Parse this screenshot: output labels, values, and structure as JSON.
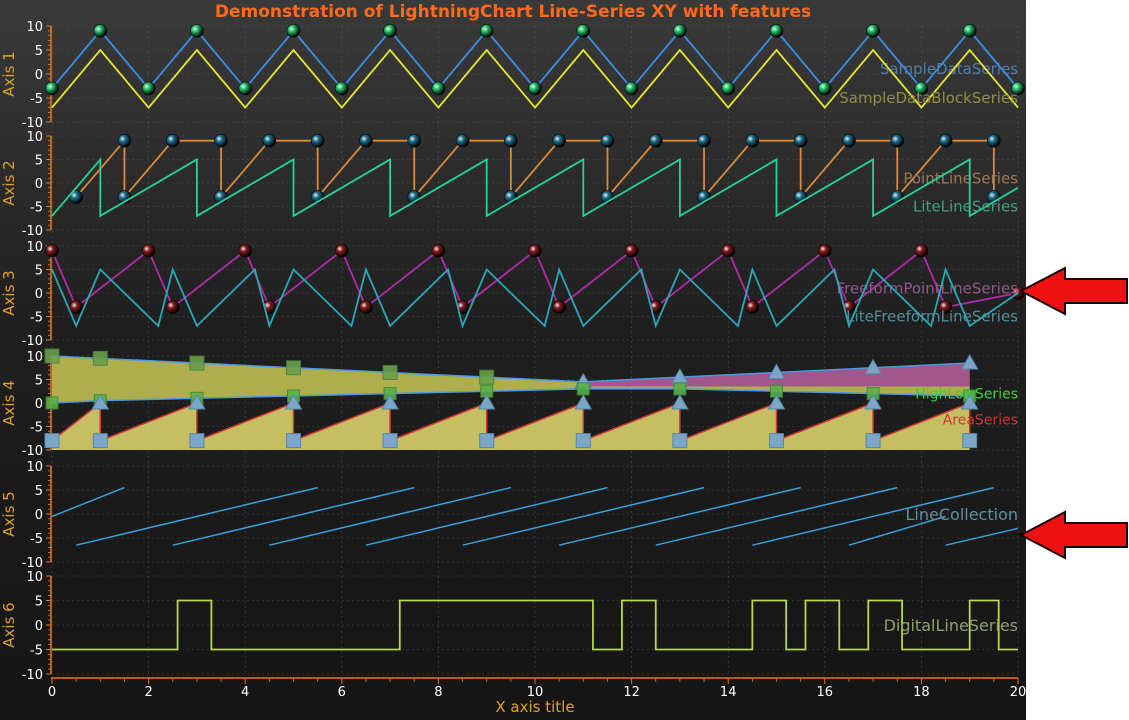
{
  "chart_data": {
    "type": "line",
    "title": "Demonstration of LightningChart Line-Series XY with features",
    "xlabel": "X axis title",
    "xlim": [
      0,
      20
    ],
    "x_ticks": [
      "0",
      "2",
      "4",
      "6",
      "8",
      "10",
      "12",
      "14",
      "16",
      "18",
      "20"
    ],
    "grid": true,
    "axes": [
      {
        "label": "Axis 1",
        "ylim": [
          -10,
          10
        ],
        "y_ticks": [
          "10",
          "5",
          "0",
          "-5",
          "-10"
        ],
        "series": [
          {
            "name": "SampleDataSeries",
            "color": "#3a8fe8",
            "label_color": "#4f7fb0",
            "marker": "circle",
            "marker_color": "#22c46a",
            "x": [
              0,
              1,
              2,
              3,
              4,
              5,
              6,
              7,
              8,
              9,
              10,
              11,
              12,
              13,
              14,
              15,
              16,
              17,
              18,
              19,
              20
            ],
            "y": [
              -3,
              9,
              -3,
              9,
              -3,
              9,
              -3,
              9,
              -3,
              9,
              -3,
              9,
              -3,
              9,
              -3,
              9,
              -3,
              9,
              -3,
              9,
              -3
            ]
          },
          {
            "name": "SampleDataBlockSeries",
            "color": "#e8e82a",
            "label_color": "#8f8f40",
            "marker": "none",
            "x": [
              0,
              1,
              2,
              3,
              4,
              5,
              6,
              7,
              8,
              9,
              10,
              11,
              12,
              13,
              14,
              15,
              16,
              17,
              18,
              19,
              20
            ],
            "y": [
              -7,
              5,
              -7,
              5,
              -7,
              5,
              -7,
              5,
              -7,
              5,
              -7,
              5,
              -7,
              5,
              -7,
              5,
              -7,
              5,
              -7,
              5,
              -7
            ]
          }
        ]
      },
      {
        "label": "Axis 2",
        "ylim": [
          -10,
          10
        ],
        "y_ticks": [
          "10",
          "5",
          "0",
          "-5",
          "-10"
        ],
        "series": [
          {
            "name": "PointLineSeries",
            "color": "#d98a3a",
            "label_color": "#a07850",
            "marker": "circle",
            "marker_color": "#1c6f8f",
            "x": [
              0.5,
              1.5,
              1.5,
              2.5,
              3.5,
              3.5,
              4.5,
              5.5,
              5.5,
              6.5,
              7.5,
              7.5,
              8.5,
              9.5,
              9.5,
              10.5,
              11.5,
              11.5,
              12.5,
              13.5,
              13.5,
              14.5,
              15.5,
              15.5,
              16.5,
              17.5,
              17.5,
              18.5,
              19.5,
              19.5
            ],
            "y": [
              -3,
              9,
              -3,
              9,
              9,
              -3,
              9,
              9,
              -3,
              9,
              9,
              -3,
              9,
              9,
              -3,
              9,
              9,
              -3,
              9,
              9,
              -3,
              9,
              9,
              -3,
              9,
              9,
              -3,
              9,
              9,
              -3
            ]
          },
          {
            "name": "LiteLineSeries",
            "color": "#22d49a",
            "label_color": "#3fa080",
            "marker": "none",
            "x": [
              0,
              1,
              1,
              3,
              3,
              5,
              5,
              7,
              7,
              9,
              9,
              11,
              11,
              13,
              13,
              15,
              15,
              17,
              17,
              19,
              19,
              20
            ],
            "y": [
              -7,
              5,
              -7,
              5,
              -7,
              5,
              -7,
              5,
              -7,
              5,
              -7,
              5,
              -7,
              5,
              -7,
              5,
              -7,
              5,
              -7,
              5,
              -7,
              -1
            ]
          }
        ]
      },
      {
        "label": "Axis 3",
        "ylim": [
          -10,
          10
        ],
        "y_ticks": [
          "10",
          "5",
          "0",
          "-5",
          "-10"
        ],
        "series": [
          {
            "name": "FreeformPointLineSeries",
            "color": "#b02aa8",
            "label_color": "#8f5a8a",
            "marker": "circle",
            "marker_color": "#8a1c1c",
            "x": [
              0,
              0.5,
              2,
              2.5,
              4,
              4.5,
              6,
              6.5,
              8,
              8.5,
              10,
              10.5,
              12,
              12.5,
              14,
              14.5,
              16,
              16.5,
              18,
              18.5,
              20
            ],
            "y": [
              9,
              -3,
              9,
              -3,
              9,
              -3,
              9,
              -3,
              9,
              -3,
              9,
              -3,
              9,
              -3,
              9,
              -3,
              9,
              -3,
              9,
              -3,
              0
            ]
          },
          {
            "name": "LiteFreeformLineSeries",
            "color": "#2aa8b8",
            "label_color": "#4f8f9a",
            "marker": "none",
            "x": [
              0,
              0.5,
              1,
              2.2,
              2.5,
              3,
              4.2,
              4.5,
              5,
              6.2,
              6.5,
              7,
              8.2,
              8.5,
              9,
              10.2,
              10.5,
              11,
              12.2,
              12.5,
              13,
              14.2,
              14.5,
              15,
              16.2,
              16.5,
              17,
              18.2,
              18.5,
              19,
              20
            ],
            "y": [
              5,
              -7,
              5,
              -7,
              5,
              -7,
              5,
              -7,
              5,
              -7,
              5,
              -7,
              5,
              -7,
              5,
              -7,
              5,
              -7,
              5,
              -7,
              5,
              -7,
              5,
              -7,
              5,
              -7,
              5,
              -7,
              5,
              -7,
              0
            ]
          }
        ]
      },
      {
        "label": "Axis 4",
        "ylim": [
          -10,
          10
        ],
        "y_ticks": [
          "10",
          "5",
          "0",
          "-5",
          "-10"
        ],
        "series": [
          {
            "name": "HighLowSeries",
            "color": "#c8c855",
            "label_color": "#3ecf3e",
            "marker": "square/triangle",
            "x": [
              0,
              1,
              3,
              5,
              7,
              9,
              11,
              13,
              15,
              17,
              19
            ],
            "high": [
              10,
              9.5,
              8.5,
              7.5,
              6.5,
              5.5,
              4.5,
              5.5,
              6.5,
              7.5,
              8.5
            ],
            "low": [
              0,
              0.5,
              1,
              1.5,
              2,
              2.5,
              3,
              3,
              2.5,
              2,
              1.5
            ]
          },
          {
            "name": "AreaSeries",
            "color": "#d8d06a",
            "label_color": "#d03535",
            "marker": "square/triangle",
            "x": [
              0,
              1,
              1,
              3,
              3,
              5,
              5,
              7,
              7,
              9,
              9,
              11,
              11,
              13,
              13,
              15,
              15,
              17,
              17,
              19,
              19
            ],
            "y": [
              -8,
              0,
              -8,
              0,
              -8,
              0,
              -8,
              0,
              -8,
              0,
              -8,
              0,
              -8,
              0,
              -8,
              0,
              -8,
              0,
              -8,
              0,
              -8
            ]
          }
        ]
      },
      {
        "label": "Axis 5",
        "ylim": [
          -10,
          10
        ],
        "y_ticks": [
          "10",
          "5",
          "0",
          "-5",
          "-10"
        ],
        "series": [
          {
            "name": "LineCollection",
            "color": "#3aa0d8",
            "label_color": "#5f8fa0",
            "marker": "none",
            "segments": [
              [
                [
                  0,
                  -0.5
                ],
                [
                  1.5,
                  5.5
                ]
              ],
              [
                [
                  0.5,
                  -6.5
                ],
                [
                  5.5,
                  5.5
                ]
              ],
              [
                [
                  2.5,
                  -6.5
                ],
                [
                  7.5,
                  5.5
                ]
              ],
              [
                [
                  4.5,
                  -6.5
                ],
                [
                  9.5,
                  5.5
                ]
              ],
              [
                [
                  6.5,
                  -6.5
                ],
                [
                  11.5,
                  5.5
                ]
              ],
              [
                [
                  8.5,
                  -6.5
                ],
                [
                  13.5,
                  5.5
                ]
              ],
              [
                [
                  10.5,
                  -6.5
                ],
                [
                  15.5,
                  5.5
                ]
              ],
              [
                [
                  12.5,
                  -6.5
                ],
                [
                  17.5,
                  5.5
                ]
              ],
              [
                [
                  14.5,
                  -6.5
                ],
                [
                  19.5,
                  5.5
                ]
              ],
              [
                [
                  16.5,
                  -6.5
                ],
                [
                  18.5,
                  -0.5
                ]
              ],
              [
                [
                  18.5,
                  -6.5
                ],
                [
                  20,
                  -3
                ]
              ]
            ]
          }
        ]
      },
      {
        "label": "Axis 6",
        "ylim": [
          -10,
          10
        ],
        "y_ticks": [
          "10",
          "5",
          "0",
          "-5",
          "-10"
        ],
        "series": [
          {
            "name": "DigitalLineSeries",
            "color": "#b6d84a",
            "label_color": "#8f9f6a",
            "marker": "none",
            "x": [
              0,
              2.6,
              2.6,
              3.3,
              3.3,
              7.2,
              7.2,
              11.2,
              11.2,
              11.8,
              11.8,
              12.5,
              12.5,
              14.5,
              14.5,
              15.2,
              15.2,
              15.6,
              15.6,
              16.3,
              16.3,
              16.9,
              16.9,
              17.6,
              17.6,
              19.0,
              19.0,
              19.6,
              19.6,
              20
            ],
            "y": [
              -5,
              -5,
              5,
              5,
              -5,
              -5,
              5,
              5,
              -5,
              -5,
              5,
              5,
              -5,
              -5,
              5,
              5,
              -5,
              -5,
              5,
              5,
              -5,
              -5,
              5,
              5,
              -5,
              -5,
              5,
              5,
              -5,
              -5
            ]
          }
        ]
      }
    ]
  },
  "colors": {
    "axis": "#e8761a",
    "axis_label": "#e0a025",
    "x_axis_title": "#e0a025",
    "arrow": "#ee1111"
  },
  "annotations": [
    {
      "icon": "red-arrow-left-icon",
      "target_series": "FreeformPointLineSeries"
    },
    {
      "icon": "red-arrow-left-icon",
      "target_series": "LineCollection"
    }
  ]
}
